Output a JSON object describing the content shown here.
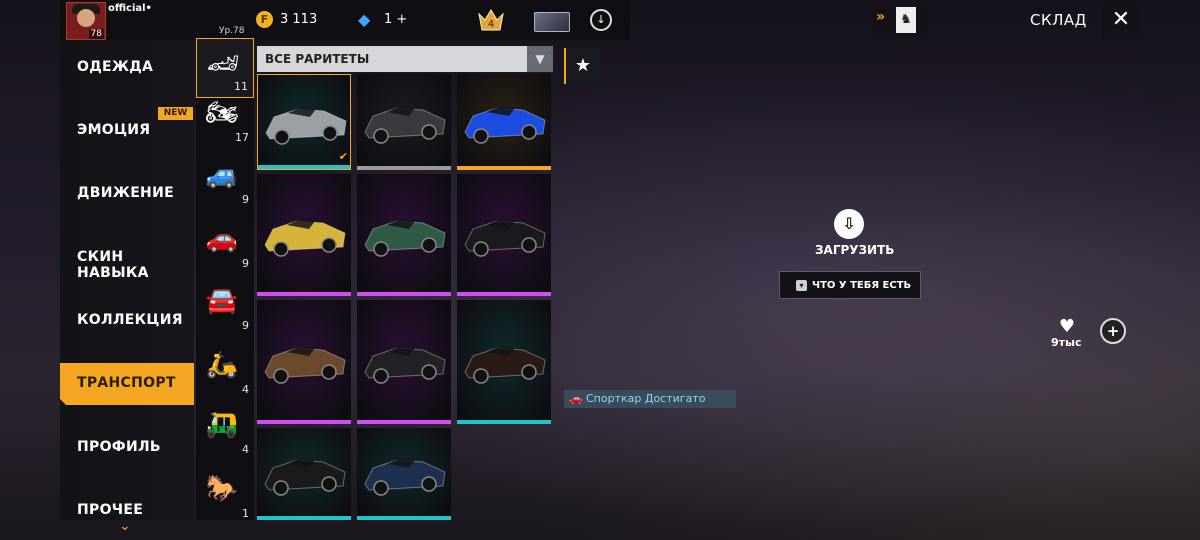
{
  "player": {
    "name": "official•",
    "level_label": "Ур.78",
    "avatar_level": "78"
  },
  "currency": {
    "coins": "3 113",
    "diamonds": "1 +"
  },
  "rank": {
    "value": "4"
  },
  "header": {
    "title": "СКЛАД",
    "close_glyph": "✕"
  },
  "nav": {
    "items": [
      {
        "label": "ОДЕЖДА"
      },
      {
        "label": "ЭМОЦИЯ"
      },
      {
        "label": "ДВИЖЕНИЕ"
      },
      {
        "label": "СКИН НАВЫКА"
      },
      {
        "label": "КОЛЛЕКЦИЯ"
      },
      {
        "label": "ТРАНСПОРТ"
      },
      {
        "label": "ПРОФИЛЬ"
      },
      {
        "label": "ПРОЧЕЕ"
      }
    ],
    "active_index": 5,
    "new_badge": "NEW"
  },
  "categories": [
    {
      "icon": "sports-car-icon",
      "count": "11",
      "glyph": "🏎"
    },
    {
      "icon": "motorcycle-icon",
      "count": "17",
      "glyph": "🏍"
    },
    {
      "icon": "monster-truck-icon",
      "count": "9",
      "glyph": "🚙"
    },
    {
      "icon": "buggy-icon",
      "count": "9",
      "glyph": "🚗"
    },
    {
      "icon": "jeep-icon",
      "count": "9",
      "glyph": "🚘"
    },
    {
      "icon": "atv-icon",
      "count": "4",
      "glyph": "🛵"
    },
    {
      "icon": "tuk-tuk-icon",
      "count": "4",
      "glyph": "🛺"
    },
    {
      "icon": "horse-icon",
      "count": "1",
      "glyph": "🐎"
    }
  ],
  "filter": {
    "label": "ВСЕ РАРИТЕТЫ"
  },
  "colors": {
    "accent": "#f5a623",
    "rarity_teal": "#22c4c8",
    "rarity_purple": "#d04ef0",
    "rarity_gray": "#9a9a9a",
    "rarity_gold": "#f5a623"
  },
  "grid": {
    "items": [
      {
        "rarity": "teal",
        "body": "#9aa0a6",
        "bg": "#0f2a2c",
        "selected": true
      },
      {
        "rarity": "gray",
        "body": "#3a3a3e",
        "bg": "#1c1c20",
        "selected": false
      },
      {
        "rarity": "gold",
        "body": "#1c4ce0",
        "bg": "#2a2212",
        "selected": false
      },
      {
        "rarity": "purple",
        "body": "#d7b33a",
        "bg": "#2a0f34",
        "selected": false
      },
      {
        "rarity": "purple",
        "body": "#2f5a46",
        "bg": "#2a0f34",
        "selected": false
      },
      {
        "rarity": "purple",
        "body": "#1a1a1e",
        "bg": "#2a0f34",
        "selected": false
      },
      {
        "rarity": "purple",
        "body": "#6a4a2a",
        "bg": "#2a0f34",
        "selected": false
      },
      {
        "rarity": "purple",
        "body": "#222226",
        "bg": "#2a0f34",
        "selected": false
      },
      {
        "rarity": "teal",
        "body": "#2a1a16",
        "bg": "#0f2a2c",
        "selected": false
      },
      {
        "rarity": "teal",
        "body": "#1a1a1a",
        "bg": "#0f2a2c",
        "selected": false
      },
      {
        "rarity": "teal",
        "body": "#1e3050",
        "bg": "#0f2a2c",
        "selected": false
      }
    ]
  },
  "preview": {
    "download_label": "ЗАГРУЗИТЬ",
    "owned_label": "ЧТО У ТЕБЯ ЕСТЬ",
    "item_name": "Спорткар Достигато",
    "likes": "9тыс"
  }
}
